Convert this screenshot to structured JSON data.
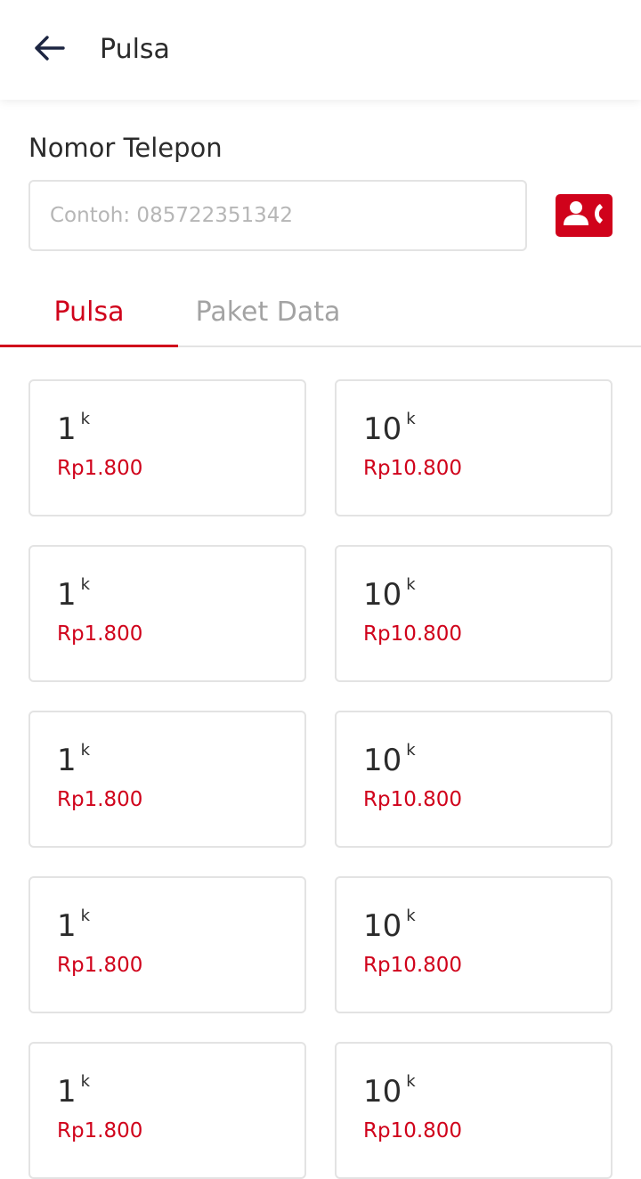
{
  "header": {
    "title": "Pulsa",
    "back_icon": "arrow-left-icon"
  },
  "form": {
    "label": "Nomor Telepon",
    "phone_value": "",
    "phone_placeholder": "Contoh: 085722351342",
    "contact_icon": "contact-phone-icon"
  },
  "tabs": [
    {
      "label": "Pulsa",
      "active": true
    },
    {
      "label": "Paket Data",
      "active": false
    }
  ],
  "colors": {
    "accent": "#d0021b",
    "inactive_tab": "#a3a3a3",
    "border": "#e3e3e3"
  },
  "products": [
    {
      "nominal": "1",
      "unit": "k",
      "price": "Rp1.800"
    },
    {
      "nominal": "10",
      "unit": "k",
      "price": "Rp10.800"
    },
    {
      "nominal": "1",
      "unit": "k",
      "price": "Rp1.800"
    },
    {
      "nominal": "10",
      "unit": "k",
      "price": "Rp10.800"
    },
    {
      "nominal": "1",
      "unit": "k",
      "price": "Rp1.800"
    },
    {
      "nominal": "10",
      "unit": "k",
      "price": "Rp10.800"
    },
    {
      "nominal": "1",
      "unit": "k",
      "price": "Rp1.800"
    },
    {
      "nominal": "10",
      "unit": "k",
      "price": "Rp10.800"
    },
    {
      "nominal": "1",
      "unit": "k",
      "price": "Rp1.800"
    },
    {
      "nominal": "10",
      "unit": "k",
      "price": "Rp10.800"
    }
  ]
}
